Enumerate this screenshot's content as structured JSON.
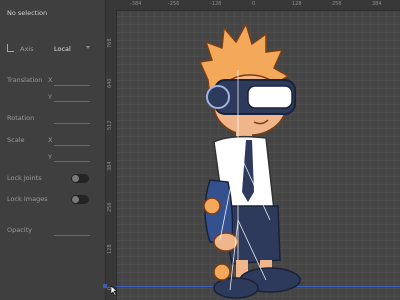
{
  "panel": {
    "selection_status": "No selection",
    "axis_label": "Axis",
    "axis_value": "Local",
    "translation_label": "Translation",
    "translation_x": "X",
    "translation_y": "Y",
    "rotation_label": "Rotation",
    "scale_label": "Scale",
    "scale_x": "X",
    "scale_y": "Y",
    "lock_joints_label": "Lock Joints",
    "lock_images_label": "Lock Images",
    "opacity_label": "Opacity"
  },
  "rulers": {
    "top": [
      "-384",
      "-256",
      "-128",
      "0",
      "128",
      "256",
      "384"
    ],
    "left": [
      "768",
      "640",
      "512",
      "384",
      "256",
      "128",
      "0"
    ]
  },
  "colors": {
    "panel_bg": "#3f3f3f",
    "viewport_bg": "#454545",
    "accent_blue": "#3b5cb8"
  }
}
